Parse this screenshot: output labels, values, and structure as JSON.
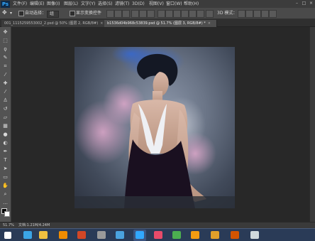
{
  "app": {
    "logo": "Ps",
    "menus": [
      "文件(F)",
      "编辑(E)",
      "图像(I)",
      "图层(L)",
      "文字(Y)",
      "选择(S)",
      "滤镜(T)",
      "3D(D)",
      "视图(V)",
      "窗口(W)",
      "帮助(H)"
    ],
    "window_controls": [
      "–",
      "□",
      "×"
    ]
  },
  "options_bar": {
    "auto_select_label": "自动选择：",
    "auto_select_value": "组",
    "show_transform_label": "显示变换控件",
    "mode_3d_label": "3D 模式："
  },
  "tabs": [
    {
      "label": "001_1115259553002_2.psd @ 50% (图层 2, RGB/8#)",
      "close": "×",
      "active": false
    },
    {
      "label": "b1536d04b968c53839.psd @ 51.7% (图层 3, RGB/8#) *",
      "close": "×",
      "active": true
    }
  ],
  "tools": [
    "move-icon",
    "marquee-icon",
    "lasso-icon",
    "quick-select-icon",
    "crop-icon",
    "eyedropper-icon",
    "healing-icon",
    "brush-icon",
    "clone-stamp-icon",
    "history-brush-icon",
    "eraser-icon",
    "gradient-icon",
    "blur-icon",
    "dodge-icon",
    "pen-icon",
    "type-icon",
    "path-select-icon",
    "shape-icon",
    "hand-icon",
    "zoom-icon",
    "more-tools-icon"
  ],
  "status_bar": {
    "zoom": "51.7%",
    "doc_info": "文档:1.21M/4.24M"
  },
  "taskbar": {
    "apps": [
      {
        "name": "start-button-icon",
        "color": "#ffffff"
      },
      {
        "name": "ie-icon",
        "color": "#3ba5e6"
      },
      {
        "name": "file-explorer-icon",
        "color": "#f0c040"
      },
      {
        "name": "illustrator-icon",
        "color": "#f08c00"
      },
      {
        "name": "powerpoint-icon",
        "color": "#d24726"
      },
      {
        "name": "app-icon-5",
        "color": "#9a9a9a"
      },
      {
        "name": "app-icon-6",
        "color": "#4aa3df"
      },
      {
        "name": "photoshop-icon",
        "color": "#31a8ff"
      },
      {
        "name": "app-icon-8",
        "color": "#e84b6a"
      },
      {
        "name": "app-icon-9",
        "color": "#4caf50"
      },
      {
        "name": "app-icon-10",
        "color": "#f39c12"
      },
      {
        "name": "app-icon-11",
        "color": "#e2a02a"
      },
      {
        "name": "app-icon-12",
        "color": "#d35400"
      },
      {
        "name": "network-icon",
        "color": "#cfd8dc"
      }
    ]
  },
  "colors": {
    "accent": "#31a8ff",
    "artwork_background": "#6b7587",
    "dress": "#1a1020"
  }
}
